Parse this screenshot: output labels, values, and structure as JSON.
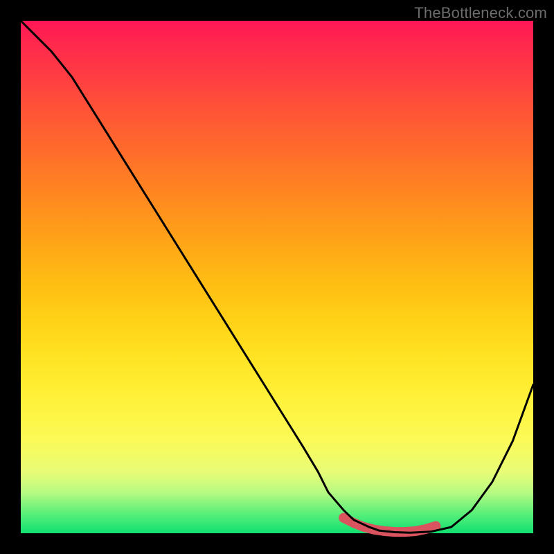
{
  "watermark": "TheBottleneck.com",
  "colors": {
    "frame": "#000000",
    "curve": "#000000",
    "marker": "#d9545f",
    "gradient_top": "#ff1656",
    "gradient_bottom": "#10e070"
  },
  "chart_data": {
    "type": "line",
    "title": "",
    "xlabel": "",
    "ylabel": "",
    "xlim": [
      0,
      100
    ],
    "ylim": [
      0,
      100
    ],
    "grid": false,
    "legend": false,
    "note": "Axes have no visible ticks or labels; values below are estimated percentages of the plot area (0 = bottom/left, 100 = top/right).",
    "x": [
      0,
      3,
      6,
      10,
      15,
      20,
      25,
      30,
      35,
      40,
      45,
      50,
      55,
      58,
      60,
      63,
      65,
      68,
      70,
      73,
      76,
      80,
      84,
      88,
      92,
      96,
      100
    ],
    "y": [
      100,
      97,
      94,
      89,
      81,
      73,
      65,
      57,
      49,
      41,
      33,
      25,
      17,
      12,
      8,
      4.5,
      2.6,
      1.2,
      0.5,
      0.2,
      0.1,
      0.3,
      1.2,
      4.5,
      10,
      18,
      29
    ],
    "marker_region": {
      "comment": "salmon-colored thick marker along the valley floor",
      "x": [
        63,
        65,
        67,
        69,
        71,
        73,
        75,
        77,
        79,
        81
      ],
      "y": [
        3.0,
        2.0,
        1.2,
        0.7,
        0.4,
        0.25,
        0.25,
        0.4,
        0.8,
        1.4
      ]
    }
  }
}
